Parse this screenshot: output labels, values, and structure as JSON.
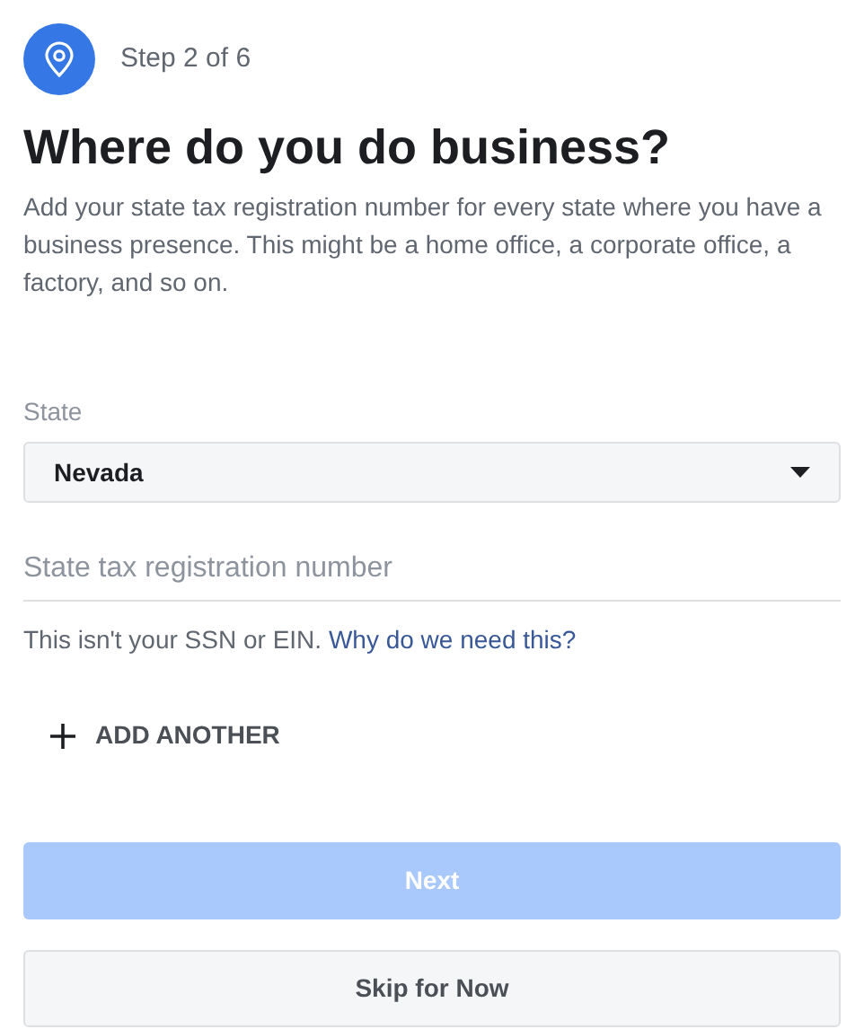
{
  "step": "Step 2 of 6",
  "title": "Where do you do business?",
  "description": "Add your state tax registration number for every state where you have a business presence. This might be a home office, a corporate office, a factory, and so on.",
  "state_field": {
    "label": "State",
    "value": "Nevada"
  },
  "tax_field": {
    "placeholder": "State tax registration number"
  },
  "help": {
    "text": "This isn't your SSN or EIN.",
    "link": "Why do we need this?"
  },
  "add_another": "ADD ANOTHER",
  "next_button": {
    "label": "Next",
    "disabled": true
  },
  "skip_button": {
    "label": "Skip for Now"
  }
}
